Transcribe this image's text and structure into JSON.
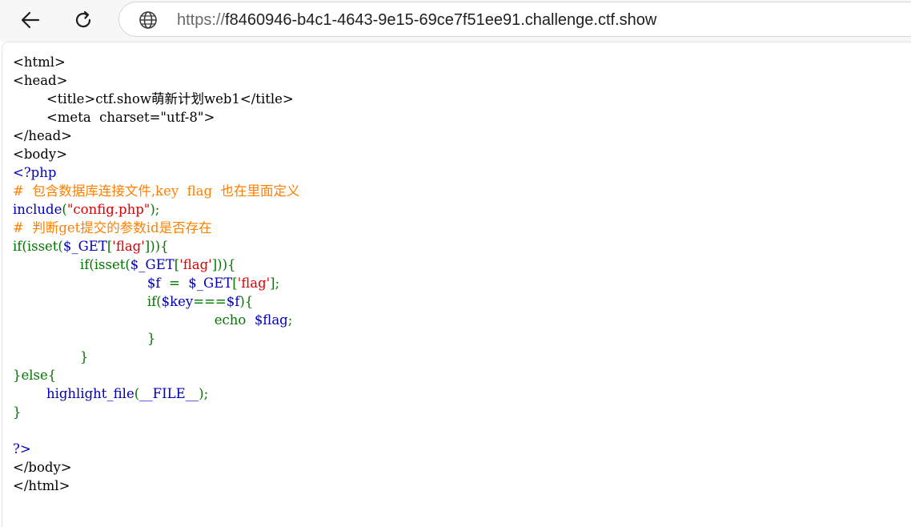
{
  "browser": {
    "url_scheme": "https://",
    "url_host": "f8460946-b4c1-4643-9e15-69ce7f51ee91.challenge.ctf.show",
    "icons": {
      "back": "arrow-left-icon",
      "reload": "reload-icon",
      "site": "globe-icon"
    }
  },
  "source": {
    "colors": {
      "html": "#000000",
      "default": "#0000bb",
      "keyword": "#007700",
      "string": "#dd0000",
      "comment": "#ff8000"
    },
    "lines": [
      [
        {
          "t": "html",
          "v": "<html>"
        }
      ],
      [
        {
          "t": "html",
          "v": "<head>"
        }
      ],
      [
        {
          "t": "html",
          "v": "        <title>ctf.show萌新计划web1</title>"
        }
      ],
      [
        {
          "t": "html",
          "v": "        <meta  charset=\"utf-8\">"
        }
      ],
      [
        {
          "t": "html",
          "v": "</head>"
        }
      ],
      [
        {
          "t": "html",
          "v": "<body>"
        }
      ],
      [
        {
          "t": "default",
          "v": "<?php"
        }
      ],
      [
        {
          "t": "comment",
          "v": "#  包含数据库连接文件,key  flag  也在里面定义"
        }
      ],
      [
        {
          "t": "default",
          "v": "include"
        },
        {
          "t": "keyword",
          "v": "("
        },
        {
          "t": "string",
          "v": "\"config.php\""
        },
        {
          "t": "keyword",
          "v": ");"
        }
      ],
      [
        {
          "t": "comment",
          "v": "#  判断get提交的参数id是否存在"
        }
      ],
      [
        {
          "t": "keyword",
          "v": "if(isset("
        },
        {
          "t": "default",
          "v": "$_GET"
        },
        {
          "t": "keyword",
          "v": "["
        },
        {
          "t": "string",
          "v": "'flag'"
        },
        {
          "t": "keyword",
          "v": "])){"
        }
      ],
      [
        {
          "t": "keyword",
          "v": "                if(isset("
        },
        {
          "t": "default",
          "v": "$_GET"
        },
        {
          "t": "keyword",
          "v": "["
        },
        {
          "t": "string",
          "v": "'flag'"
        },
        {
          "t": "keyword",
          "v": "])){"
        }
      ],
      [
        {
          "t": "default",
          "v": "                                $f  "
        },
        {
          "t": "keyword",
          "v": "=  "
        },
        {
          "t": "default",
          "v": "$_GET"
        },
        {
          "t": "keyword",
          "v": "["
        },
        {
          "t": "string",
          "v": "'flag'"
        },
        {
          "t": "keyword",
          "v": "];"
        }
      ],
      [
        {
          "t": "keyword",
          "v": "                                if("
        },
        {
          "t": "default",
          "v": "$key"
        },
        {
          "t": "keyword",
          "v": "==="
        },
        {
          "t": "default",
          "v": "$f"
        },
        {
          "t": "keyword",
          "v": "){"
        }
      ],
      [
        {
          "t": "keyword",
          "v": "                                                echo  "
        },
        {
          "t": "default",
          "v": "$flag"
        },
        {
          "t": "keyword",
          "v": ";"
        }
      ],
      [
        {
          "t": "keyword",
          "v": "                                }"
        }
      ],
      [
        {
          "t": "keyword",
          "v": "                }"
        }
      ],
      [
        {
          "t": "keyword",
          "v": "}else{"
        }
      ],
      [
        {
          "t": "default",
          "v": "        highlight_file"
        },
        {
          "t": "keyword",
          "v": "("
        },
        {
          "t": "default",
          "v": "__FILE__"
        },
        {
          "t": "keyword",
          "v": ");"
        }
      ],
      [
        {
          "t": "keyword",
          "v": "}"
        }
      ],
      [
        {
          "t": "html",
          "v": ""
        }
      ],
      [
        {
          "t": "default",
          "v": "?>"
        }
      ],
      [
        {
          "t": "html",
          "v": "</body>"
        }
      ],
      [
        {
          "t": "html",
          "v": "</html>"
        }
      ]
    ]
  }
}
